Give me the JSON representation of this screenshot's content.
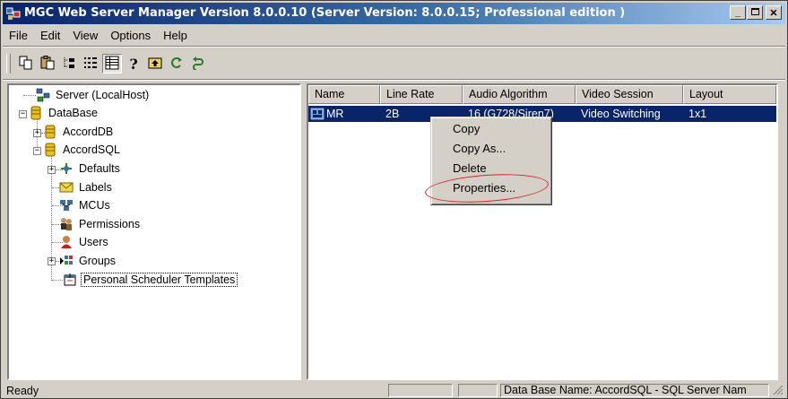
{
  "window": {
    "title": "MGC Web Server Manager Version 8.0.0.10  (Server Version: 8.0.0.15;  Professional edition )"
  },
  "menu": [
    "File",
    "Edit",
    "View",
    "Options",
    "Help"
  ],
  "toolbar": [
    "copy-icon",
    "paste-icon",
    "tree-view-icon",
    "list-view-icon",
    "details-view-icon",
    "help-icon",
    "up-folder-icon",
    "refresh-icon",
    "undo-icon"
  ],
  "tree": {
    "server": "Server (LocalHost)",
    "database": "DataBase",
    "accorddb": "AccordDB",
    "accordsql": "AccordSQL",
    "defaults": "Defaults",
    "labels": "Labels",
    "mcus": "MCUs",
    "permissions": "Permissions",
    "users": "Users",
    "groups": "Groups",
    "templates": "Personal Scheduler Templates"
  },
  "list": {
    "columns": [
      "Name",
      "Line Rate",
      "Audio Algorithm",
      "Video Session",
      "Layout"
    ],
    "rows": [
      {
        "name": "MR",
        "line_rate": "2B",
        "audio": "16 (G728/Siren7)",
        "video": "Video Switching",
        "layout": "1x1"
      }
    ]
  },
  "context_menu": [
    "Copy",
    "Copy As...",
    "Delete",
    "Properties..."
  ],
  "status": {
    "left": "Ready",
    "right": "Data Base Name: AccordSQL - SQL Server Nam"
  },
  "colors": {
    "selection": "#0a246a",
    "highlight_ellipse": "#dd2222",
    "face": "#d4d0c8"
  }
}
